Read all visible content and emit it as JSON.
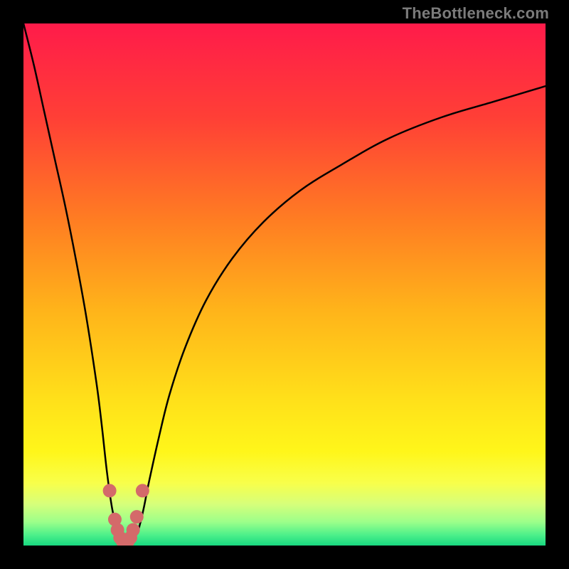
{
  "watermark": "TheBottleneck.com",
  "colors": {
    "black": "#000000",
    "curve": "#000000",
    "marker": "#d46a6a",
    "gradient_stops": [
      {
        "offset": 0.0,
        "color": "#ff1b4a"
      },
      {
        "offset": 0.18,
        "color": "#ff3f36"
      },
      {
        "offset": 0.38,
        "color": "#ff7e22"
      },
      {
        "offset": 0.55,
        "color": "#ffb41a"
      },
      {
        "offset": 0.72,
        "color": "#ffe01a"
      },
      {
        "offset": 0.82,
        "color": "#fff61a"
      },
      {
        "offset": 0.88,
        "color": "#f8ff4a"
      },
      {
        "offset": 0.92,
        "color": "#d7ff7a"
      },
      {
        "offset": 0.955,
        "color": "#9cff8a"
      },
      {
        "offset": 0.98,
        "color": "#4cf08a"
      },
      {
        "offset": 1.0,
        "color": "#18d880"
      }
    ]
  },
  "chart_data": {
    "type": "line",
    "title": "",
    "xlabel": "",
    "ylabel": "",
    "xlim": [
      0,
      100
    ],
    "ylim": [
      0,
      100
    ],
    "grid": false,
    "legend": false,
    "series": [
      {
        "name": "bottleneck-curve",
        "x": [
          0,
          2,
          4,
          6,
          8,
          10,
          12,
          14,
          15,
          16,
          17,
          18,
          19,
          20,
          21,
          22,
          23,
          24,
          26,
          28,
          31,
          35,
          40,
          46,
          53,
          61,
          70,
          80,
          90,
          100
        ],
        "values": [
          100,
          92,
          83,
          74,
          65,
          55,
          44,
          31,
          23,
          14,
          7,
          3,
          1,
          0,
          1,
          3,
          7,
          12,
          21,
          29,
          38,
          47,
          55,
          62,
          68,
          73,
          78,
          82,
          85,
          88
        ]
      }
    ],
    "markers": {
      "name": "valley-markers",
      "x": [
        16.5,
        17.5,
        18.0,
        18.5,
        19.0,
        19.5,
        20.0,
        20.5,
        21.0,
        21.7,
        22.8
      ],
      "values": [
        10.5,
        5.0,
        3.0,
        1.5,
        0.8,
        0.5,
        0.8,
        1.5,
        3.0,
        5.5,
        10.5
      ]
    }
  }
}
